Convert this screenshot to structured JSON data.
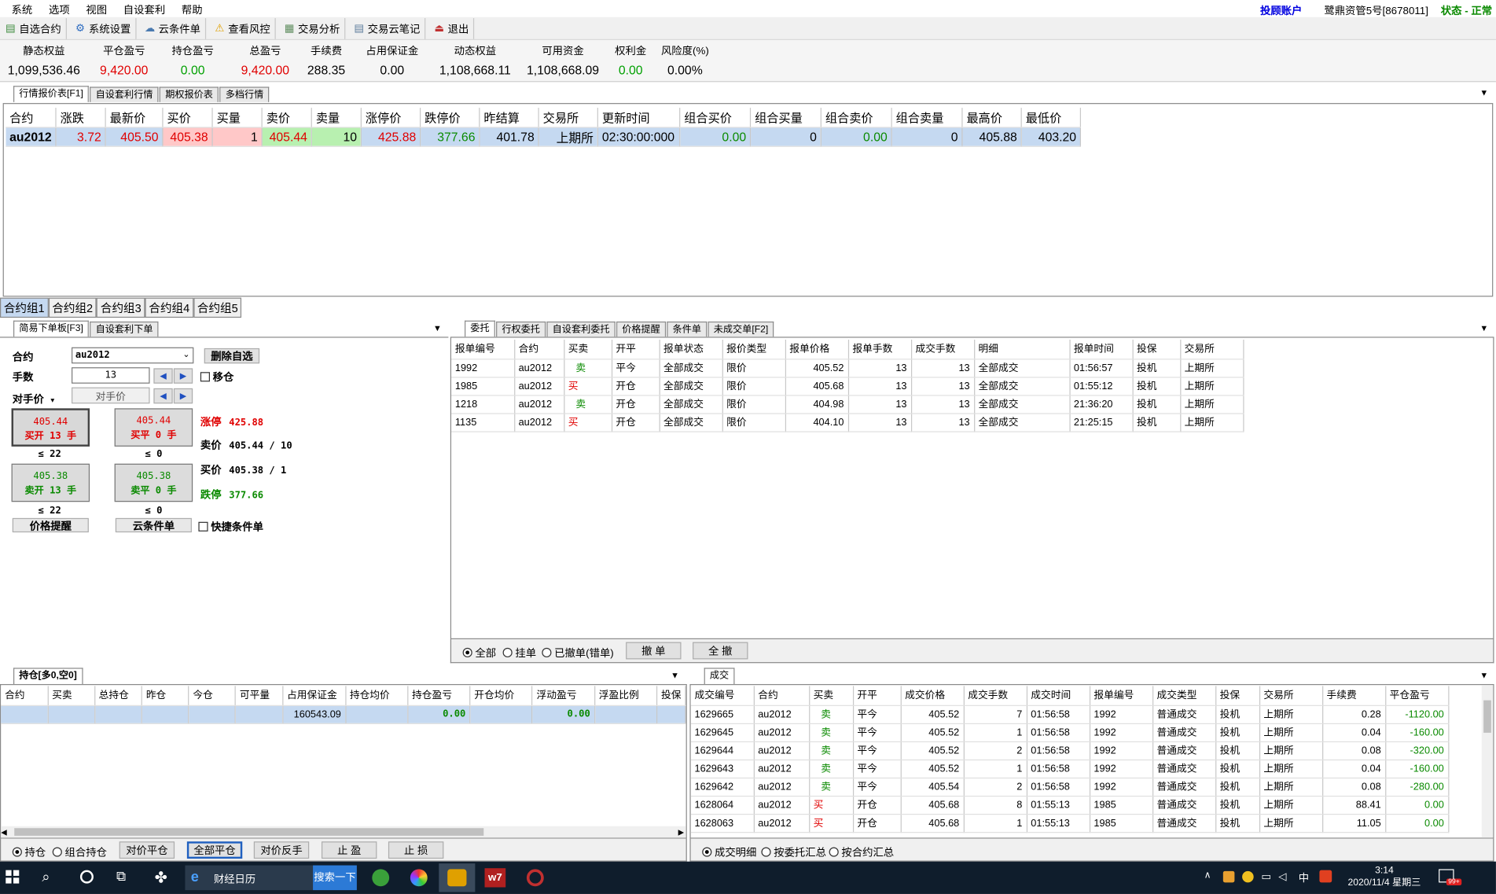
{
  "menu": [
    "系统",
    "选项",
    "视图",
    "自设套利",
    "帮助"
  ],
  "account": {
    "label": "投顾账户",
    "name": "鹭鼎资管5号[8678011]",
    "status": "状态 - 正常"
  },
  "toolbar": [
    "自选合约",
    "系统设置",
    "云条件单",
    "查看风控",
    "交易分析",
    "交易云笔记",
    "退出"
  ],
  "summary": [
    {
      "label": "静态权益",
      "value": "1,099,536.46",
      "color": "#000"
    },
    {
      "label": "平仓盈亏",
      "value": "9,420.00",
      "color": "#e00000"
    },
    {
      "label": "持仓盈亏",
      "value": "0.00",
      "color": "#00a000"
    },
    {
      "label": "总盈亏",
      "value": "9,420.00",
      "color": "#e00000"
    },
    {
      "label": "手续费",
      "value": "288.35",
      "color": "#000"
    },
    {
      "label": "占用保证金",
      "value": "0.00",
      "color": "#000"
    },
    {
      "label": "动态权益",
      "value": "1,108,668.11",
      "color": "#000"
    },
    {
      "label": "可用资金",
      "value": "1,108,668.09",
      "color": "#000"
    },
    {
      "label": "权利金",
      "value": "0.00",
      "color": "#00a000"
    },
    {
      "label": "风险度(%)",
      "value": "0.00%",
      "color": "#000"
    }
  ],
  "quote_tabs": [
    "行情报价表[F1]",
    "自设套利行情",
    "期权报价表",
    "多档行情"
  ],
  "quote": {
    "headers": [
      "合约",
      "涨跌",
      "最新价",
      "买价",
      "买量",
      "卖价",
      "卖量",
      "涨停价",
      "跌停价",
      "昨结算",
      "交易所",
      "更新时间",
      "组合买价",
      "组合买量",
      "组合卖价",
      "组合卖量",
      "最高价",
      "最低价"
    ],
    "row": [
      "au2012",
      "3.72",
      "405.50",
      "405.38",
      "1",
      "405.44",
      "10",
      "425.88",
      "377.66",
      "401.78",
      "上期所",
      "02:30:00:000",
      "0.00",
      "0",
      "0.00",
      "0",
      "405.88",
      "403.20"
    ]
  },
  "group_tabs": [
    "合约组1",
    "合约组2",
    "合约组3",
    "合约组4",
    "合约组5"
  ],
  "order_tabs": [
    "简易下单板[F3]",
    "自设套利下单"
  ],
  "order_panel": {
    "contract_label": "合约",
    "contract": "au2012",
    "delete_btn": "删除自选",
    "qty_label": "手数",
    "qty": "13",
    "move_label": "移仓",
    "price_label": "对手价",
    "price_value": "对手价",
    "btn1_price": "405.44",
    "btn1_label": "买开 13 手",
    "btn1_sub": "≤ 22",
    "btn2_price": "405.44",
    "btn2_label": "买平 0 手",
    "btn2_sub": "≤ 0",
    "btn3_price": "405.38",
    "btn3_label": "卖开 13 手",
    "btn3_sub": "≤ 22",
    "btn4_price": "405.38",
    "btn4_label": "卖平 0 手",
    "btn4_sub": "≤ 0",
    "limit_up_label": "涨停",
    "limit_up": "425.88",
    "ask_label": "卖价",
    "ask": "405.44 / 10",
    "bid_label": "买价",
    "bid": "405.38 / 1",
    "limit_down_label": "跌停",
    "limit_down": "377.66",
    "alert_btn": "价格提醒",
    "cloud_btn": "云条件单",
    "quick_label": "快捷条件单"
  },
  "entrust_tabs": [
    "委托",
    "行权委托",
    "自设套利委托",
    "价格提醒",
    "条件单",
    "未成交单[F2]"
  ],
  "entrust": {
    "headers": [
      "报单编号",
      "合约",
      "买卖",
      "开平",
      "报单状态",
      "报价类型",
      "报单价格",
      "报单手数",
      "成交手数",
      "明细",
      "报单时间",
      "投保",
      "交易所"
    ],
    "rows": [
      [
        "1992",
        "au2012",
        "卖",
        "平今",
        "全部成交",
        "限价",
        "405.52",
        "13",
        "13",
        "全部成交",
        "01:56:57",
        "投机",
        "上期所"
      ],
      [
        "1985",
        "au2012",
        "买",
        "开仓",
        "全部成交",
        "限价",
        "405.68",
        "13",
        "13",
        "全部成交",
        "01:55:12",
        "投机",
        "上期所"
      ],
      [
        "1218",
        "au2012",
        "卖",
        "开仓",
        "全部成交",
        "限价",
        "404.98",
        "13",
        "13",
        "全部成交",
        "21:36:20",
        "投机",
        "上期所"
      ],
      [
        "1135",
        "au2012",
        "买",
        "开仓",
        "全部成交",
        "限价",
        "404.10",
        "13",
        "13",
        "全部成交",
        "21:25:15",
        "投机",
        "上期所"
      ]
    ],
    "filters": [
      "全部",
      "挂单",
      "已撤单(错单)"
    ],
    "cancel_btn": "撤 单",
    "cancel_all_btn": "全 撤"
  },
  "position_tabs": [
    "持仓[多0,空0]"
  ],
  "position": {
    "headers": [
      "合约",
      "买卖",
      "总持仓",
      "昨仓",
      "今仓",
      "可平量",
      "占用保证金",
      "持仓均价",
      "持仓盈亏",
      "开仓均价",
      "浮动盈亏",
      "浮盈比例",
      "投保"
    ],
    "row": [
      "",
      "",
      "",
      "",
      "",
      "",
      "160543.09",
      "",
      "0.00",
      "",
      "0.00",
      "",
      ""
    ],
    "filters": [
      "持仓",
      "组合持仓"
    ],
    "buttons": [
      "对价平仓",
      "全部平仓",
      "对价反手",
      "止 盈",
      "止 损"
    ]
  },
  "trade_tabs": [
    "成交"
  ],
  "trades": {
    "headers": [
      "成交编号",
      "合约",
      "买卖",
      "开平",
      "成交价格",
      "成交手数",
      "成交时间",
      "报单编号",
      "成交类型",
      "投保",
      "交易所",
      "手续费",
      "平仓盈亏"
    ],
    "rows": [
      [
        "1629665",
        "au2012",
        "卖",
        "平今",
        "405.52",
        "7",
        "01:56:58",
        "1992",
        "普通成交",
        "投机",
        "上期所",
        "0.28",
        "-1120.00"
      ],
      [
        "1629645",
        "au2012",
        "卖",
        "平今",
        "405.52",
        "1",
        "01:56:58",
        "1992",
        "普通成交",
        "投机",
        "上期所",
        "0.04",
        "-160.00"
      ],
      [
        "1629644",
        "au2012",
        "卖",
        "平今",
        "405.52",
        "2",
        "01:56:58",
        "1992",
        "普通成交",
        "投机",
        "上期所",
        "0.08",
        "-320.00"
      ],
      [
        "1629643",
        "au2012",
        "卖",
        "平今",
        "405.52",
        "1",
        "01:56:58",
        "1992",
        "普通成交",
        "投机",
        "上期所",
        "0.04",
        "-160.00"
      ],
      [
        "1629642",
        "au2012",
        "卖",
        "平今",
        "405.54",
        "2",
        "01:56:58",
        "1992",
        "普通成交",
        "投机",
        "上期所",
        "0.08",
        "-280.00"
      ],
      [
        "1628064",
        "au2012",
        "买",
        "开仓",
        "405.68",
        "8",
        "01:55:13",
        "1985",
        "普通成交",
        "投机",
        "上期所",
        "88.41",
        "0.00"
      ],
      [
        "1628063",
        "au2012",
        "买",
        "开仓",
        "405.68",
        "1",
        "01:55:13",
        "1985",
        "普通成交",
        "投机",
        "上期所",
        "11.05",
        "0.00"
      ]
    ],
    "filters": [
      "成交明细",
      "按委托汇总",
      "按合约汇总"
    ]
  },
  "taskbar": {
    "app1": "财经日历",
    "search_btn": "搜索一下",
    "time": "3:14",
    "date": "2020/11/4 星期三",
    "ime": "中",
    "badge": "99+"
  }
}
